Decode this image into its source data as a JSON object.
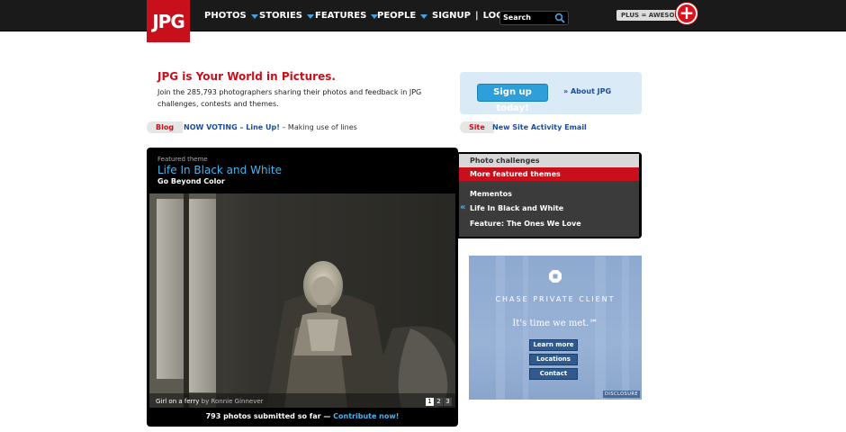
{
  "header": {
    "logo": "JPG",
    "nav": [
      "PHOTOS",
      "STORIES",
      "FEATURES",
      "PEOPLE"
    ],
    "signup": "SIGNUP",
    "separator": "|",
    "login": "LOGIN",
    "search_placeholder": "Search",
    "plus_label": "PLUS = AWESOME",
    "plus_badge": "+"
  },
  "intro": {
    "headline": "JPG is Your World in Pictures.",
    "body": "Join the 285,793 photographers sharing their photos and feedback in JPG challenges, contests and themes."
  },
  "blog": {
    "label": "Blog",
    "link": "NOW VOTING – Line Up!",
    "suffix": " – Making use of lines"
  },
  "site": {
    "label": "Site",
    "link": "New Site Activity Email"
  },
  "signup_box": {
    "button": "Sign up today!",
    "about": "» About JPG"
  },
  "featured": {
    "kicker": "Featured theme",
    "title": "Life In Black and White",
    "subtitle": "Go Beyond Color",
    "caption_title": "Girl on a ferry",
    "caption_by": " by Ronnie Ginnever",
    "pages": [
      "1",
      "2",
      "3"
    ],
    "submitted": "793 photos submitted so far — ",
    "contribute": "Contribute now!"
  },
  "themes": {
    "tab_photo": "Photo challenges",
    "tab_more": "More featured themes",
    "items": [
      "Mementos",
      "Life In Black and White",
      "Feature: The Ones We Love"
    ],
    "current_marker": "«"
  },
  "ad": {
    "brand": "CHASE PRIVATE CLIENT",
    "tagline": "It's time we met.℠",
    "buttons": [
      "Learn more",
      "Locations",
      "Contact"
    ],
    "disclosure": "DISCLOSURE"
  }
}
